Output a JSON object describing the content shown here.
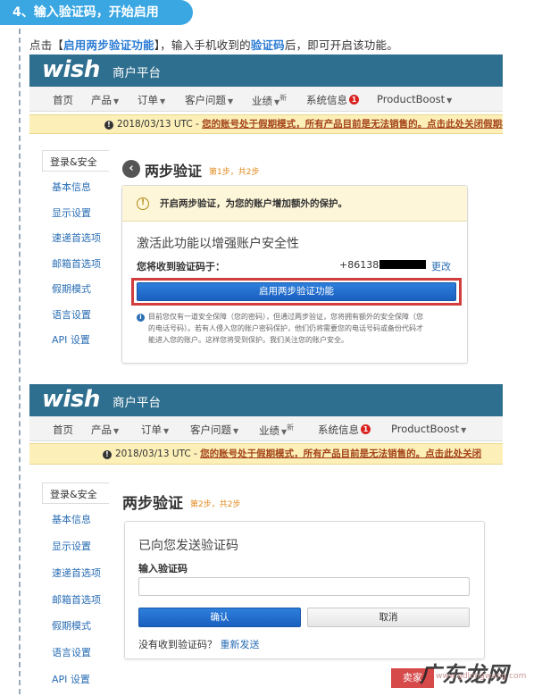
{
  "step_heading": "4、输入验证码，开始启用",
  "instruction": {
    "part1": "点击【",
    "highlight1": "启用两步验证功能",
    "part2": "】，输入手机收到的",
    "highlight2": "验证码",
    "part3": "后，即可开启该功能。"
  },
  "app": {
    "logo": "wish",
    "platform": "商户平台"
  },
  "nav": {
    "home": "首页",
    "products": "产品",
    "orders": "订单",
    "customer_issues": "客户问题",
    "performance": "业绩",
    "performance_new": "新",
    "system_info": "系统信息",
    "system_info_badge": "1",
    "productboost": "ProductBoost"
  },
  "banner": {
    "prefix": "2018/03/13 UTC -",
    "warning_p1": "您的账号处于假期模式，所有产品目前是无法销售的。点击此处关闭假期模",
    "warning_p2": "您的账号处于假期模式，所有产品目前是无法销售的。点击此处关闭"
  },
  "sidebar": {
    "items": [
      "登录&安全",
      "基本信息",
      "显示设置",
      "速递首选项",
      "邮箱首选项",
      "假期模式",
      "语言设置",
      "API 设置"
    ]
  },
  "panel1": {
    "title": "两步验证",
    "step": "第1步，共2步",
    "notice": "开启两步验证，为您的账户增加额外的保护。",
    "card_title": "激活此功能以增强账户安全性",
    "send_to_label": "您将收到验证码于：",
    "phone_prefix": "+86138",
    "change_link": "更改",
    "enable_button": "启用两步验证功能",
    "note_line1": "目前您仅有一道安全保障（您的密码），但通过两步验证，您将拥有额外的安全保障（您",
    "note_line2": "的电话号码）。若有人侵入您的账户密码保护，他们仍将需要您的电话号码或备份代码才",
    "note_line3": "能进入您的账户。这样您将受到保护。我们关注您的账户安全。"
  },
  "panel2": {
    "title": "两步验证",
    "step": "第2步，共2步",
    "card_title": "已向您发送验证码",
    "input_label": "输入验证码",
    "code_value": "",
    "confirm_button": "确认",
    "cancel_button": "取消",
    "no_code_text": "没有收到验证码？",
    "resend_link": "重新发送"
  },
  "watermark": {
    "tag": "卖家",
    "brand": "广东龙网",
    "site": "www.gdlongwang.com"
  },
  "colors": {
    "header_bg": "#2e6e8e",
    "step_tag": "#3aa7e3",
    "banner_bg": "#fcf0b8",
    "primary_btn": "#1f6fd1",
    "highlight_border": "#d23d3d",
    "link": "#2a6eb4"
  }
}
